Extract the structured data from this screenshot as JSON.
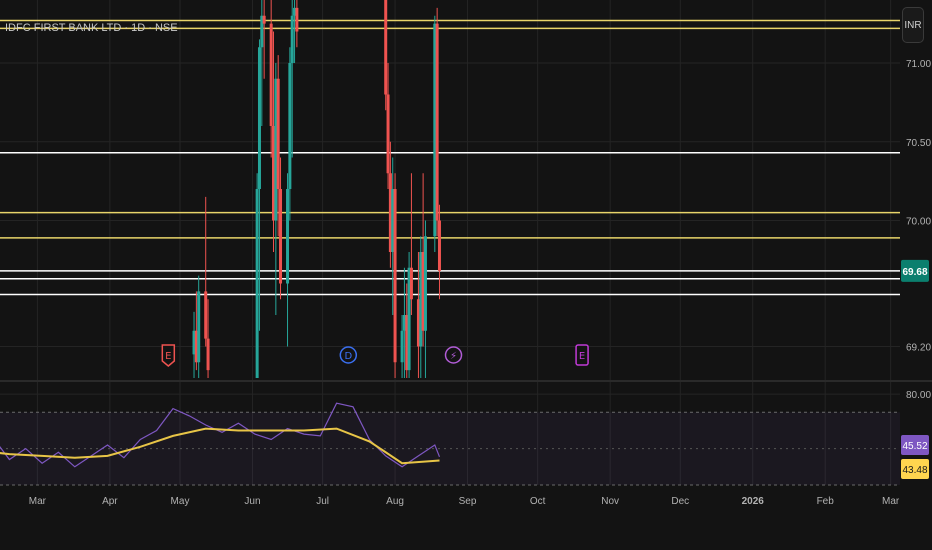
{
  "header": {
    "symbol_title": "IDFC FIRST BANK LTD · 1D · NSE",
    "currency_button": "INR"
  },
  "colors": {
    "background": "#131313",
    "grid": "#242424",
    "up_candle": "#26a69a",
    "down_candle": "#ef5350",
    "support_white": "#ffffff",
    "support_yellow": "#e8d46a",
    "rsi_line": "#7e57c2",
    "rsi_ma": "#e8c547",
    "price_badge": "#0b7f6e",
    "rsi_badge": "#7e57c2",
    "rsi_ma_badge": "#ffd54f",
    "earnings_marker": "#ef5350",
    "dividend_marker": "#3a6ff0",
    "split_marker": "#b15cd6",
    "events_marker": "#c03ad6"
  },
  "chart_data": [
    {
      "type": "candlestick",
      "title": "",
      "xlabel": "",
      "ylabel": "",
      "ylim": [
        69.0,
        71.4
      ],
      "y_ticks": [
        "71.00",
        "70.50",
        "70.00",
        "69.20"
      ],
      "last_price": "69.68",
      "horizontal_levels": [
        {
          "value": 71.27,
          "color": "yellow"
        },
        {
          "value": 71.22,
          "color": "yellow"
        },
        {
          "value": 70.43,
          "color": "white"
        },
        {
          "value": 70.05,
          "color": "yellow"
        },
        {
          "value": 69.89,
          "color": "yellow"
        },
        {
          "value": 69.68,
          "color": "white"
        },
        {
          "value": 69.63,
          "color": "white"
        },
        {
          "value": 69.53,
          "color": "white"
        }
      ],
      "candles": [
        {
          "x": "2025-05-07",
          "o": 69.15,
          "h": 69.42,
          "l": 69.0,
          "c": 69.3
        },
        {
          "x": "2025-05-08",
          "o": 69.3,
          "h": 69.55,
          "l": 69.05,
          "c": 69.1
        },
        {
          "x": "2025-05-09",
          "o": 69.1,
          "h": 69.65,
          "l": 69.0,
          "c": 69.55
        },
        {
          "x": "2025-05-12",
          "o": 69.55,
          "h": 70.15,
          "l": 69.2,
          "c": 69.25
        },
        {
          "x": "2025-05-13",
          "o": 69.25,
          "h": 69.5,
          "l": 69.0,
          "c": 69.05
        },
        {
          "x": "2025-06-03",
          "o": 69.0,
          "h": 70.3,
          "l": 69.0,
          "c": 70.2
        },
        {
          "x": "2025-06-04",
          "o": 70.2,
          "h": 71.15,
          "l": 69.3,
          "c": 71.1
        },
        {
          "x": "2025-06-05",
          "o": 71.1,
          "h": 71.4,
          "l": 70.6,
          "c": 71.3
        },
        {
          "x": "2025-06-06",
          "o": 71.3,
          "h": 71.4,
          "l": 70.9,
          "c": 71.25
        },
        {
          "x": "2025-06-09",
          "o": 71.25,
          "h": 71.4,
          "l": 70.4,
          "c": 70.6
        },
        {
          "x": "2025-06-10",
          "o": 70.6,
          "h": 71.2,
          "l": 69.8,
          "c": 70.0
        },
        {
          "x": "2025-06-11",
          "o": 70.0,
          "h": 71.0,
          "l": 69.4,
          "c": 70.9
        },
        {
          "x": "2025-06-12",
          "o": 70.9,
          "h": 71.05,
          "l": 69.9,
          "c": 70.2
        },
        {
          "x": "2025-06-13",
          "o": 70.2,
          "h": 70.4,
          "l": 69.5,
          "c": 69.6
        },
        {
          "x": "2025-06-16",
          "o": 69.6,
          "h": 70.3,
          "l": 69.2,
          "c": 70.2
        },
        {
          "x": "2025-06-17",
          "o": 70.2,
          "h": 71.1,
          "l": 70.0,
          "c": 71.0
        },
        {
          "x": "2025-06-18",
          "o": 71.0,
          "h": 71.4,
          "l": 70.4,
          "c": 71.3
        },
        {
          "x": "2025-06-19",
          "o": 71.3,
          "h": 71.4,
          "l": 71.0,
          "c": 71.35
        },
        {
          "x": "2025-06-20",
          "o": 71.35,
          "h": 71.4,
          "l": 71.1,
          "c": 71.2
        },
        {
          "x": "2025-07-28",
          "o": 71.4,
          "h": 71.4,
          "l": 70.7,
          "c": 70.8
        },
        {
          "x": "2025-07-29",
          "o": 70.8,
          "h": 71.0,
          "l": 70.2,
          "c": 70.3
        },
        {
          "x": "2025-07-30",
          "o": 70.3,
          "h": 70.5,
          "l": 69.7,
          "c": 69.8
        },
        {
          "x": "2025-07-31",
          "o": 69.8,
          "h": 70.4,
          "l": 69.4,
          "c": 70.2
        },
        {
          "x": "2025-08-01",
          "o": 70.2,
          "h": 70.3,
          "l": 69.0,
          "c": 69.1
        },
        {
          "x": "2025-08-04",
          "o": 69.1,
          "h": 69.4,
          "l": 69.0,
          "c": 69.3
        },
        {
          "x": "2025-08-05",
          "o": 69.3,
          "h": 69.7,
          "l": 69.0,
          "c": 69.4
        },
        {
          "x": "2025-08-06",
          "o": 69.4,
          "h": 69.6,
          "l": 69.0,
          "c": 69.05
        },
        {
          "x": "2025-08-07",
          "o": 69.05,
          "h": 69.8,
          "l": 69.0,
          "c": 69.7
        },
        {
          "x": "2025-08-08",
          "o": 69.7,
          "h": 70.3,
          "l": 69.4,
          "c": 69.5
        },
        {
          "x": "2025-08-11",
          "o": 69.5,
          "h": 69.8,
          "l": 69.0,
          "c": 69.2
        },
        {
          "x": "2025-08-12",
          "o": 69.2,
          "h": 69.9,
          "l": 69.0,
          "c": 69.8
        },
        {
          "x": "2025-08-13",
          "o": 69.8,
          "h": 70.3,
          "l": 69.2,
          "c": 69.3
        },
        {
          "x": "2025-08-14",
          "o": 69.3,
          "h": 70.0,
          "l": 69.0,
          "c": 69.9
        },
        {
          "x": "2025-08-18",
          "o": 69.9,
          "h": 71.3,
          "l": 69.8,
          "c": 71.25
        },
        {
          "x": "2025-08-19",
          "o": 71.25,
          "h": 71.35,
          "l": 69.9,
          "c": 70.0
        },
        {
          "x": "2025-08-20",
          "o": 70.0,
          "h": 70.1,
          "l": 69.5,
          "c": 69.68
        }
      ]
    },
    {
      "type": "line",
      "title": "",
      "xlabel": "",
      "ylabel": "",
      "ylim": [
        30,
        85
      ],
      "y_ticks": [
        "80.00"
      ],
      "band": [
        70,
        30
      ],
      "midline": 50,
      "series": [
        {
          "name": "RSI",
          "x": [
            "2025-02-03",
            "2025-02-10",
            "2025-02-17",
            "2025-02-24",
            "2025-03-03",
            "2025-03-10",
            "2025-03-17",
            "2025-03-24",
            "2025-03-31",
            "2025-04-07",
            "2025-04-14",
            "2025-04-21",
            "2025-04-28",
            "2025-05-05",
            "2025-05-12",
            "2025-05-19",
            "2025-05-26",
            "2025-06-02",
            "2025-06-09",
            "2025-06-16",
            "2025-06-23",
            "2025-06-30",
            "2025-07-07",
            "2025-07-14",
            "2025-07-21",
            "2025-07-28",
            "2025-08-04",
            "2025-08-11",
            "2025-08-18",
            "2025-08-20"
          ],
          "values": [
            52,
            56,
            44,
            50,
            42,
            48,
            40,
            46,
            52,
            45,
            55,
            60,
            72,
            68,
            63,
            59,
            64,
            58,
            55,
            61,
            58,
            57,
            75,
            73,
            55,
            46,
            40,
            46,
            52,
            45.52
          ]
        },
        {
          "name": "RSI-based MA",
          "x": [
            "2025-02-03",
            "2025-02-17",
            "2025-03-03",
            "2025-03-17",
            "2025-03-31",
            "2025-04-14",
            "2025-04-28",
            "2025-05-12",
            "2025-05-26",
            "2025-06-09",
            "2025-06-23",
            "2025-07-07",
            "2025-07-21",
            "2025-08-04",
            "2025-08-20"
          ],
          "values": [
            49,
            47,
            46,
            45,
            46,
            51,
            57,
            61,
            60,
            60,
            60,
            61,
            54,
            42,
            43.48
          ]
        }
      ],
      "last_values": [
        "45.52",
        "43.48"
      ]
    }
  ],
  "x_axis_labels": [
    {
      "label": "Mar",
      "date": "2025-03-01"
    },
    {
      "label": "Apr",
      "date": "2025-04-01"
    },
    {
      "label": "May",
      "date": "2025-05-01"
    },
    {
      "label": "Jun",
      "date": "2025-06-01"
    },
    {
      "label": "Jul",
      "date": "2025-07-01"
    },
    {
      "label": "Aug",
      "date": "2025-08-01"
    },
    {
      "label": "Sep",
      "date": "2025-09-01"
    },
    {
      "label": "Oct",
      "date": "2025-10-01"
    },
    {
      "label": "Nov",
      "date": "2025-11-01"
    },
    {
      "label": "Dec",
      "date": "2025-12-01"
    },
    {
      "label": "2026",
      "date": "2026-01-01"
    },
    {
      "label": "Feb",
      "date": "2026-02-01"
    },
    {
      "label": "Mar",
      "date": "2026-03-01"
    }
  ],
  "event_markers": [
    {
      "type": "earnings",
      "date": "2025-04-26",
      "glyph": "E",
      "icon": "earnings-flag-icon"
    },
    {
      "type": "dividend",
      "date": "2025-07-12",
      "glyph": "D",
      "icon": "dividend-circle-icon"
    },
    {
      "type": "split",
      "date": "2025-08-26",
      "glyph": "⚡",
      "icon": "lightning-icon"
    },
    {
      "type": "events",
      "date": "2025-10-20",
      "glyph": "E",
      "icon": "upcoming-earnings-icon"
    }
  ]
}
